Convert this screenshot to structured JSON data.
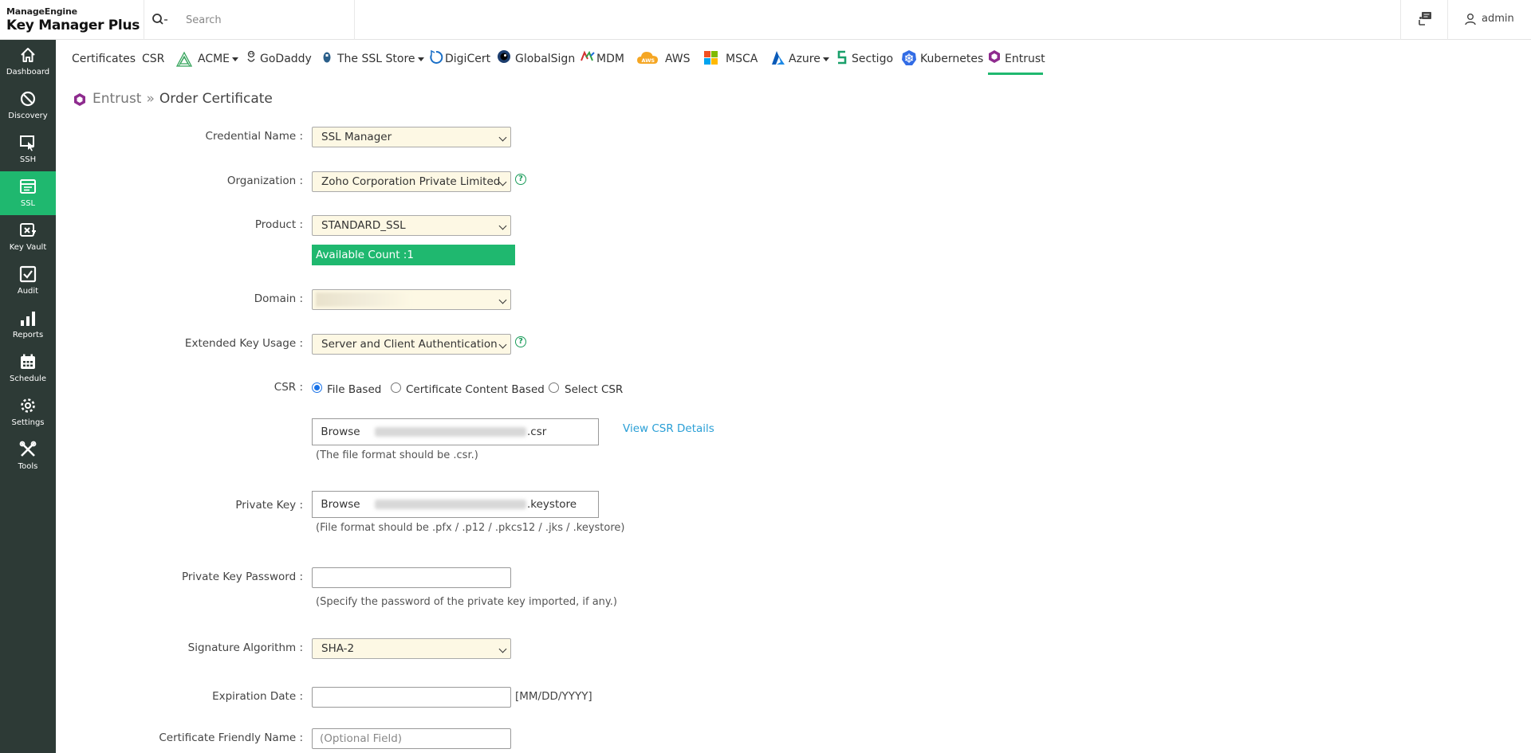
{
  "header": {
    "brand_top": "ManageEngine",
    "brand_main": "Key Manager Plus",
    "search_placeholder": "Search",
    "user": "admin"
  },
  "sidebar": {
    "items": [
      {
        "label": "Dashboard",
        "icon": "home-icon"
      },
      {
        "label": "Discovery",
        "icon": "discovery-icon"
      },
      {
        "label": "SSH",
        "icon": "ssh-icon"
      },
      {
        "label": "SSL",
        "icon": "ssl-icon",
        "active": true
      },
      {
        "label": "Key Vault",
        "icon": "key-vault-icon"
      },
      {
        "label": "Audit",
        "icon": "audit-icon"
      },
      {
        "label": "Reports",
        "icon": "reports-icon"
      },
      {
        "label": "Schedule",
        "icon": "schedule-icon"
      },
      {
        "label": "Settings",
        "icon": "settings-icon"
      },
      {
        "label": "Tools",
        "icon": "tools-icon"
      }
    ]
  },
  "tabs": {
    "certificates": "Certificates",
    "csr": "CSR",
    "acme": "ACME",
    "godaddy": "GoDaddy",
    "sslstore": "The SSL Store",
    "digicert": "DigiCert",
    "globalsign": "GlobalSign",
    "mdm": "MDM",
    "aws": "AWS",
    "msca": "MSCA",
    "azure": "Azure",
    "sectigo": "Sectigo",
    "kubernetes": "Kubernetes",
    "entrust": "Entrust",
    "aws_badge": "AWS"
  },
  "breadcrumb": {
    "parent": "Entrust",
    "separator": "»",
    "current": "Order Certificate"
  },
  "form": {
    "credential_label": "Credential Name :",
    "credential_value": "SSL Manager",
    "org_label": "Organization :",
    "org_value": "Zoho Corporation Private Limited",
    "product_label": "Product :",
    "product_value": "STANDARD_SSL",
    "available_count": "Available Count :1",
    "domain_label": "Domain :",
    "eku_label": "Extended Key Usage :",
    "eku_value": "Server and Client Authentication",
    "csr_label": "CSR :",
    "csr_opt_file": "File Based",
    "csr_opt_content": "Certificate Content Based",
    "csr_opt_select": "Select CSR",
    "browse": "Browse",
    "csr_file_ext": ".csr",
    "view_csr": "View CSR Details",
    "csr_hint": "(The file format should be .csr.)",
    "pk_label": "Private Key :",
    "pk_file_ext": ".keystore",
    "pk_hint": "(File format should be .pfx / .p12 / .pkcs12 / .jks / .keystore)",
    "pkpw_label": "Private Key Password :",
    "pkpw_hint": "(Specify the password of the private key imported, if any.)",
    "sig_label": "Signature Algorithm :",
    "sig_value": "SHA-2",
    "exp_label": "Expiration Date :",
    "exp_format": "[MM/DD/YYYY]",
    "friendly_label": "Certificate Friendly Name :",
    "friendly_placeholder": "(Optional Field)",
    "help": "?"
  },
  "colors": {
    "sidebar_bg": "#2d3a36",
    "accent_green": "#1fb86f",
    "select_bg": "#fdf8e4",
    "link_blue": "#2a9fd6"
  }
}
